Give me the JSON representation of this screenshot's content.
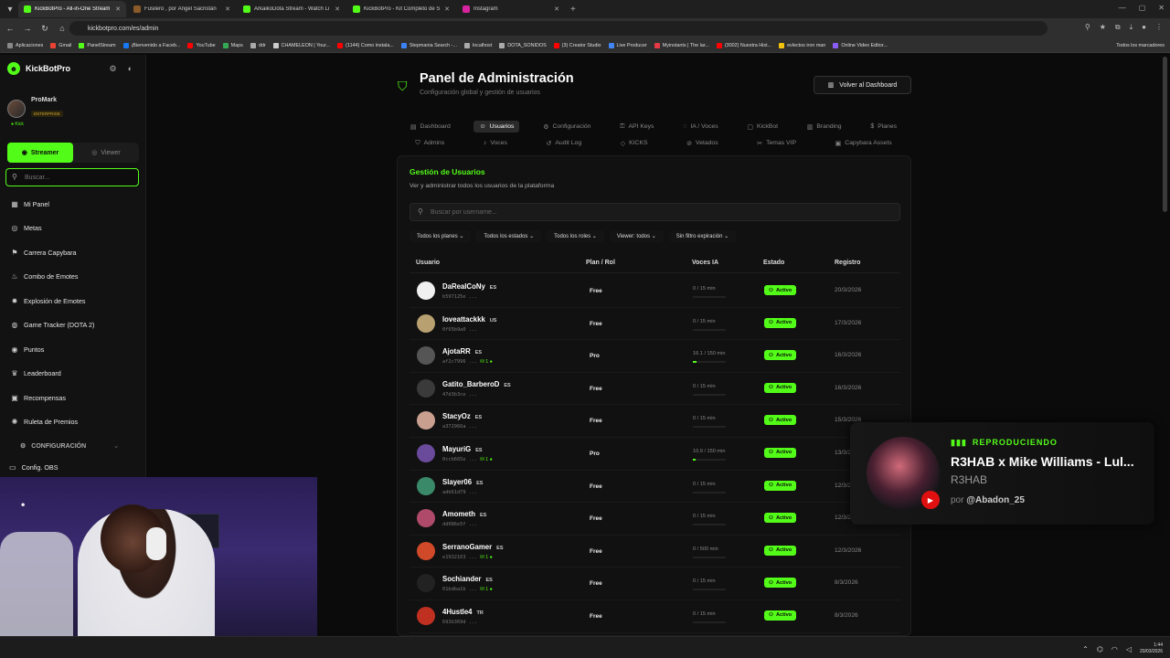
{
  "browser": {
    "tabs": [
      {
        "title": "KickBotPro - All-in-One Stream",
        "color": "#53fc18"
      },
      {
        "title": "Fusilero , por Ángel Sacristán",
        "color": "#8a5a2a"
      },
      {
        "title": "ArkaikoDota Stream - Watch Li",
        "color": "#53fc18"
      },
      {
        "title": "KickBotPro - Kit Completo de S",
        "color": "#53fc18"
      },
      {
        "title": "Instagram",
        "color": "#d6249f"
      }
    ],
    "url": "kickbotpro.com/es/admin",
    "bookmarks": [
      "Aplicaciones",
      "Gmail",
      "PanelStream",
      "¡Bienvenido a Faceb...",
      "YouTube",
      "Maps",
      "ddr",
      "CHAMELEON | Your...",
      "(1144) Como instala...",
      "Stepmania Search -...",
      "localhost",
      "DOTA_SONIDOS",
      "(3) Creator Studio",
      "Live Producer",
      "Myinstants | The lar...",
      "(3002) Nuestra Hist...",
      "evlectos iron man",
      "Online Video Editor..."
    ],
    "bookmarks_right": "Todos los marcadores"
  },
  "sidebar": {
    "brand": "KickBotPro",
    "user": "ProMark",
    "tier": "ENTERPRISE",
    "platform": "● Kick",
    "mode_streamer": "Streamer",
    "mode_viewer": "Viewer",
    "search_placeholder": "Buscar...",
    "items": [
      {
        "label": "Mi Panel",
        "icon": "panel-icon",
        "glyph": "▦"
      },
      {
        "label": "Metas",
        "icon": "target-icon",
        "glyph": "◎"
      },
      {
        "label": "Carrera Capybara",
        "icon": "race-icon",
        "glyph": "⚑"
      },
      {
        "label": "Combo de Emotes",
        "icon": "fire-icon",
        "glyph": "♨"
      },
      {
        "label": "Explosión de Emotes",
        "icon": "explosion-icon",
        "glyph": "✹"
      },
      {
        "label": "Game Tracker (DOTA 2)",
        "icon": "gamepad-icon",
        "glyph": "◍"
      },
      {
        "label": "Puntos",
        "icon": "coin-icon",
        "glyph": "◉"
      },
      {
        "label": "Leaderboard",
        "icon": "trophy-icon",
        "glyph": "♛"
      },
      {
        "label": "Recompensas",
        "icon": "gift-icon",
        "glyph": "▣"
      },
      {
        "label": "Ruleta de Premios",
        "icon": "wheel-icon",
        "glyph": "✺"
      }
    ],
    "config_header": "CONFIGURACIÓN",
    "config_obs": "Config. OBS"
  },
  "admin": {
    "title": "Panel de Administración",
    "subtitle": "Configuración global y gestión de usuarios",
    "back_button": "Volver al Dashboard",
    "tabs_row1": [
      {
        "label": "Dashboard",
        "glyph": "▤",
        "selected": false
      },
      {
        "label": "Usuarios",
        "glyph": "☺",
        "selected": true
      },
      {
        "label": "Configuración",
        "glyph": "⚙",
        "selected": false
      },
      {
        "label": "API Keys",
        "glyph": "⚿",
        "selected": false
      },
      {
        "label": "IA / Voces",
        "glyph": "◌",
        "selected": false
      },
      {
        "label": "KickBot",
        "glyph": "▢",
        "selected": false
      },
      {
        "label": "Branding",
        "glyph": "▥",
        "selected": false
      },
      {
        "label": "Planes",
        "glyph": "$",
        "selected": false
      }
    ],
    "tabs_row2": [
      {
        "label": "Admins",
        "glyph": "⛉"
      },
      {
        "label": "Voces",
        "glyph": "♪"
      },
      {
        "label": "Audit Log",
        "glyph": "↺"
      },
      {
        "label": "KICKS",
        "glyph": "◇"
      },
      {
        "label": "Vetados",
        "glyph": "⊘"
      },
      {
        "label": "Temas VIP",
        "glyph": "✂"
      },
      {
        "label": "Capybara Assets",
        "glyph": "▣"
      }
    ],
    "section_title": "Gestión de Usuarios",
    "section_desc": "Ver y administrar todos los usuarios de la plataforma",
    "search_placeholder": "Buscar por username...",
    "filters": [
      "Todos los planes ⌄",
      "Todos los estados ⌄",
      "Todos los roles ⌄",
      "Viewer: todos ⌄",
      "Sin filtro expiración ⌄"
    ],
    "columns": [
      "Usuario",
      "Plan / Rol",
      "Voces IA",
      "Estado",
      "Registro"
    ],
    "users": [
      {
        "name": "DaRealCoNy",
        "lang": "ES",
        "id": "b597125e ...",
        "kick": "",
        "plan": "Free",
        "voices": "0 / 15 min",
        "used": 0,
        "status": "Activo",
        "date": "20/3/2026",
        "av": "#f0f0f0"
      },
      {
        "name": "loveattackkk",
        "lang": "US",
        "id": "0f65b9a0 ...",
        "kick": "",
        "plan": "Free",
        "voices": "0 / 15 min",
        "used": 0,
        "status": "Activo",
        "date": "17/3/2026",
        "av": "#b8a070"
      },
      {
        "name": "AjotaRR",
        "lang": "ES",
        "id": "af2c7996 ...",
        "kick": "⛁ 1 ●",
        "plan": "Pro",
        "voices": "16.1 / 150 min",
        "used": 0.11,
        "status": "Activo",
        "date": "16/3/2026",
        "av": "#555"
      },
      {
        "name": "Gatito_BarberoD",
        "lang": "ES",
        "id": "47d3b3ce ...",
        "kick": "",
        "plan": "Free",
        "voices": "0 / 15 min",
        "used": 0,
        "status": "Activo",
        "date": "16/3/2026",
        "av": "#3a3a3a"
      },
      {
        "name": "StacyOz",
        "lang": "ES",
        "id": "a372966a ...",
        "kick": "",
        "plan": "Free",
        "voices": "0 / 15 min",
        "used": 0,
        "status": "Activo",
        "date": "15/3/2026",
        "av": "#c9a090"
      },
      {
        "name": "MayuriG",
        "lang": "ES",
        "id": "0ccb665e ...",
        "kick": "⛁ 1 ●",
        "plan": "Pro",
        "voices": "10.9 / 150 min",
        "used": 0.07,
        "status": "Activo",
        "date": "13/3/2026",
        "av": "#6a4a9a"
      },
      {
        "name": "Slayer06",
        "lang": "ES",
        "id": "adb61d79 ...",
        "kick": "",
        "plan": "Free",
        "voices": "0 / 15 min",
        "used": 0,
        "status": "Activo",
        "date": "12/3/2026",
        "av": "#3a8a6a"
      },
      {
        "name": "Amometh",
        "lang": "ES",
        "id": "dd086e5f ...",
        "kick": "",
        "plan": "Free",
        "voices": "0 / 15 min",
        "used": 0,
        "status": "Activo",
        "date": "12/3/2026",
        "av": "#b04a6a"
      },
      {
        "name": "SerranoGamer",
        "lang": "ES",
        "id": "e1932163 ...",
        "kick": "⛁ 1 ●",
        "plan": "Free",
        "voices": "0 / 500 min",
        "used": 0,
        "status": "Activo",
        "date": "12/3/2026",
        "av": "#d04a2a"
      },
      {
        "name": "Sochiander",
        "lang": "ES",
        "id": "01bdba1b ...",
        "kick": "⛁ 1 ●",
        "plan": "Free",
        "voices": "0 / 15 min",
        "used": 0,
        "status": "Activo",
        "date": "8/3/2026",
        "av": "#222"
      },
      {
        "name": "4Hustle4",
        "lang": "TR",
        "id": "693b369d ...",
        "kick": "",
        "plan": "Free",
        "voices": "0 / 15 min",
        "used": 0,
        "status": "Activo",
        "date": "8/3/2026",
        "av": "#c03020"
      }
    ]
  },
  "now_playing": {
    "label": "REPRODUCIENDO",
    "title": "R3HAB x Mike Williams - Lul...",
    "artist": "R3HAB",
    "by_prefix": "por",
    "by_user": "@Abadon_25"
  },
  "taskbar": {
    "time": "1:44",
    "date": "20/03/2026"
  },
  "colors": {
    "accent": "#53fc18",
    "background": "#0b0b0b"
  }
}
